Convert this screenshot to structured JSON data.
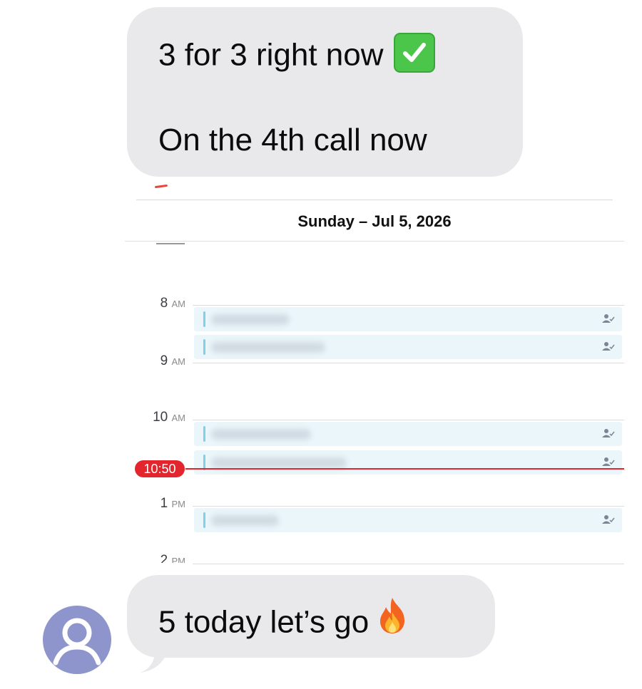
{
  "messages": [
    {
      "line1": "3 for 3 right now",
      "line1_emoji": "check-mark-button",
      "line2": "On the 4th call now"
    },
    {
      "text": "5 today let’s go",
      "emoji": "fire"
    }
  ],
  "calendar": {
    "date_header": "Sunday – Jul 5, 2026",
    "hours": [
      {
        "num": "8",
        "ampm": "AM"
      },
      {
        "num": "9",
        "ampm": "AM"
      },
      {
        "num": "10",
        "ampm": "AM"
      },
      {
        "num": "1",
        "ampm": "PM"
      },
      {
        "num": "2",
        "ampm": "PM"
      }
    ],
    "current_time": "10:50",
    "accent_color": "#e3252d",
    "event_color": "#7fd0e8"
  },
  "colors": {
    "bubble": "#e9e9eb",
    "avatar": "#8e94cc"
  }
}
